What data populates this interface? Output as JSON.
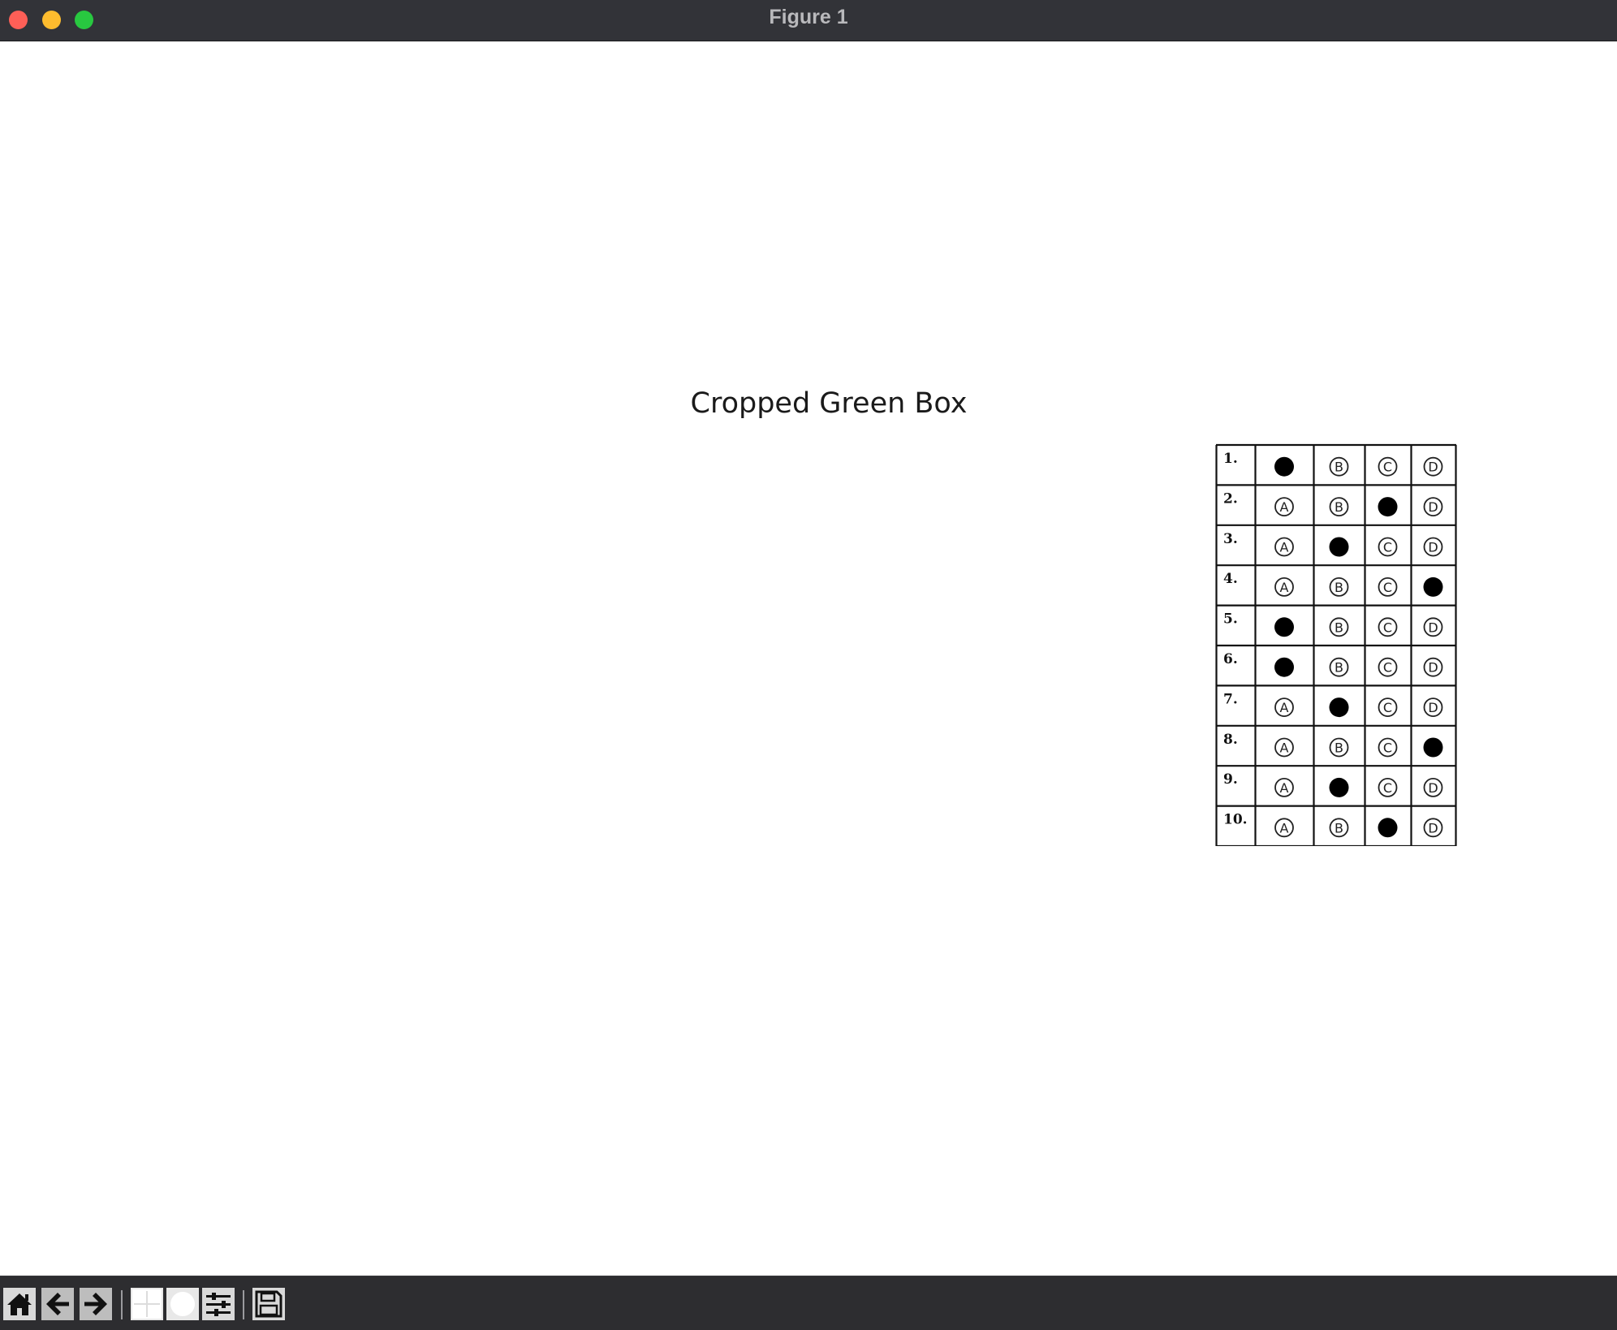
{
  "window": {
    "title": "Figure 1",
    "controls": [
      "close",
      "minimize",
      "maximize"
    ]
  },
  "axes": {
    "title": "Cropped Green Box"
  },
  "answer_sheet": {
    "options": [
      "A",
      "B",
      "C",
      "D"
    ],
    "rows": [
      {
        "number": "1.",
        "filled": "A"
      },
      {
        "number": "2.",
        "filled": "C"
      },
      {
        "number": "3.",
        "filled": "B"
      },
      {
        "number": "4.",
        "filled": "D"
      },
      {
        "number": "5.",
        "filled": "A"
      },
      {
        "number": "6.",
        "filled": "A"
      },
      {
        "number": "7.",
        "filled": "B"
      },
      {
        "number": "8.",
        "filled": "D"
      },
      {
        "number": "9.",
        "filled": "B"
      },
      {
        "number": "10.",
        "filled": "C"
      }
    ]
  },
  "toolbar": {
    "buttons": [
      {
        "name": "home-button",
        "icon": "home-icon"
      },
      {
        "name": "back-button",
        "icon": "arrow-left-icon"
      },
      {
        "name": "forward-button",
        "icon": "arrow-right-icon"
      },
      {
        "name": "pan-button",
        "icon": "pan-icon"
      },
      {
        "name": "zoom-button",
        "icon": "zoom-icon"
      },
      {
        "name": "configure-subplots-button",
        "icon": "sliders-icon"
      },
      {
        "name": "save-button",
        "icon": "save-icon"
      }
    ]
  },
  "colors": {
    "titlebar": "#323338",
    "toolbar": "#2d2d30",
    "close": "#fe5f57",
    "minimize": "#febc2e",
    "maximize": "#28c840"
  }
}
